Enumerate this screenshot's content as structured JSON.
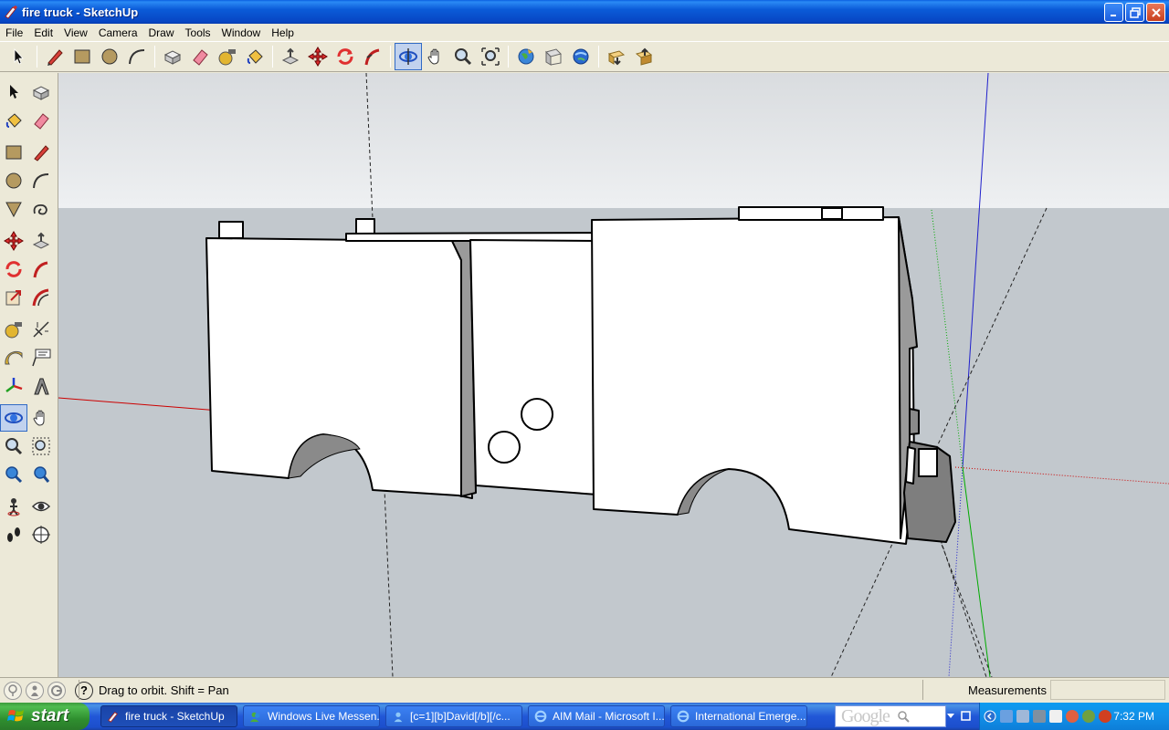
{
  "window": {
    "title": "fire truck - SketchUp",
    "controls": [
      "minimize",
      "restore",
      "close"
    ]
  },
  "menu": [
    "File",
    "Edit",
    "View",
    "Camera",
    "Draw",
    "Tools",
    "Window",
    "Help"
  ],
  "toolbar": {
    "tools": [
      "select",
      "pencil",
      "rectangle",
      "circle",
      "arc",
      "make-component",
      "eraser",
      "tape-measure",
      "paint-bucket",
      "push-pull",
      "move",
      "rotate",
      "follow-me",
      "orbit",
      "pan",
      "zoom",
      "zoom-extents",
      "get-models",
      "share-model",
      "google-earth",
      "get-current-view",
      "toggle-terrain"
    ],
    "active": "orbit"
  },
  "left_toolbar": {
    "rows": [
      [
        "select",
        "make-component"
      ],
      [
        "paint-bucket",
        "eraser"
      ],
      [
        "rectangle",
        "line"
      ],
      [
        "circle",
        "arc"
      ],
      [
        "polygon",
        "freehand"
      ],
      [
        "move",
        "push-pull"
      ],
      [
        "rotate",
        "follow-me"
      ],
      [
        "scale",
        "offset"
      ],
      [
        "tape-measure",
        "dimensions"
      ],
      [
        "protractor",
        "text"
      ],
      [
        "axes",
        "3d-text"
      ],
      [
        "orbit",
        "pan"
      ],
      [
        "zoom",
        "zoom-window"
      ],
      [
        "previous-view",
        "zoom-extents"
      ],
      [
        "position-camera",
        "look-around"
      ],
      [
        "walk",
        "section-plane"
      ]
    ],
    "active": "orbit"
  },
  "status": {
    "text": "Drag to orbit.  Shift = Pan",
    "measurements_label": "Measurements",
    "measurements_value": ""
  },
  "taskbar": {
    "start_label": "start",
    "tasks": [
      {
        "label": "fire truck - SketchUp",
        "active": true
      },
      {
        "label": "Windows Live Messen...",
        "active": false
      },
      {
        "label": "[c=1][b]David[/b][/c...",
        "active": false
      },
      {
        "label": "AIM Mail - Microsoft I...",
        "active": false
      },
      {
        "label": "International Emerge...",
        "active": false
      }
    ],
    "search_logo": "Google",
    "clock": "7:32 PM"
  },
  "colors": {
    "sky": "#eef0f2",
    "ground": "#c2c8cd",
    "axis_red": "#cc0000",
    "axis_green": "#00aa00",
    "axis_blue": "#0000cc"
  }
}
